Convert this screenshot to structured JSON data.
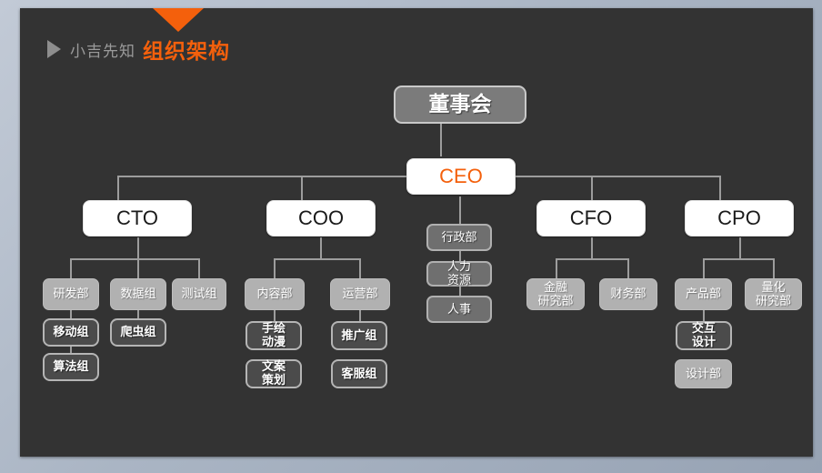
{
  "header": {
    "play_icon": "play-triangle-icon",
    "brand": "小吉先知",
    "title": "组织架构",
    "marker_icon": "down-triangle-marker"
  },
  "colors": {
    "accent": "#f4600c",
    "canvas": "#333333",
    "frame": "#aab5c4",
    "connector": "#9d9d9d",
    "dept_fill": "#b1b1b1",
    "team_fill": "#4b4b4b",
    "exec_fill": "#ffffff",
    "board_fill": "#7b7b7b"
  },
  "chart": {
    "type": "org-chart",
    "root": "董事会",
    "nodes": {
      "board": "董事会",
      "ceo": "CEO",
      "cto": "CTO",
      "coo": "COO",
      "cfo": "CFO",
      "cpo": "CPO",
      "admin": "行政部",
      "hr_resource": "人力\n资源",
      "personnel": "人事",
      "rnd": "研发部",
      "data_group": "数据组",
      "test_group": "测试组",
      "mobile_group": "移动组",
      "algo_group": "算法组",
      "crawler_group": "爬虫组",
      "content_dept": "内容部",
      "ops_dept": "运营部",
      "hand_anime": "手绘\n动漫",
      "copywriting": "文案\n策划",
      "promo_group": "推广组",
      "service_group": "客服组",
      "fin_research": "金融\n研究部",
      "finance_dept": "财务部",
      "product_dept": "产品部",
      "quant_research": "量化\n研究部",
      "interaction_design": "交互\n设计",
      "design_dept": "设计部"
    }
  }
}
